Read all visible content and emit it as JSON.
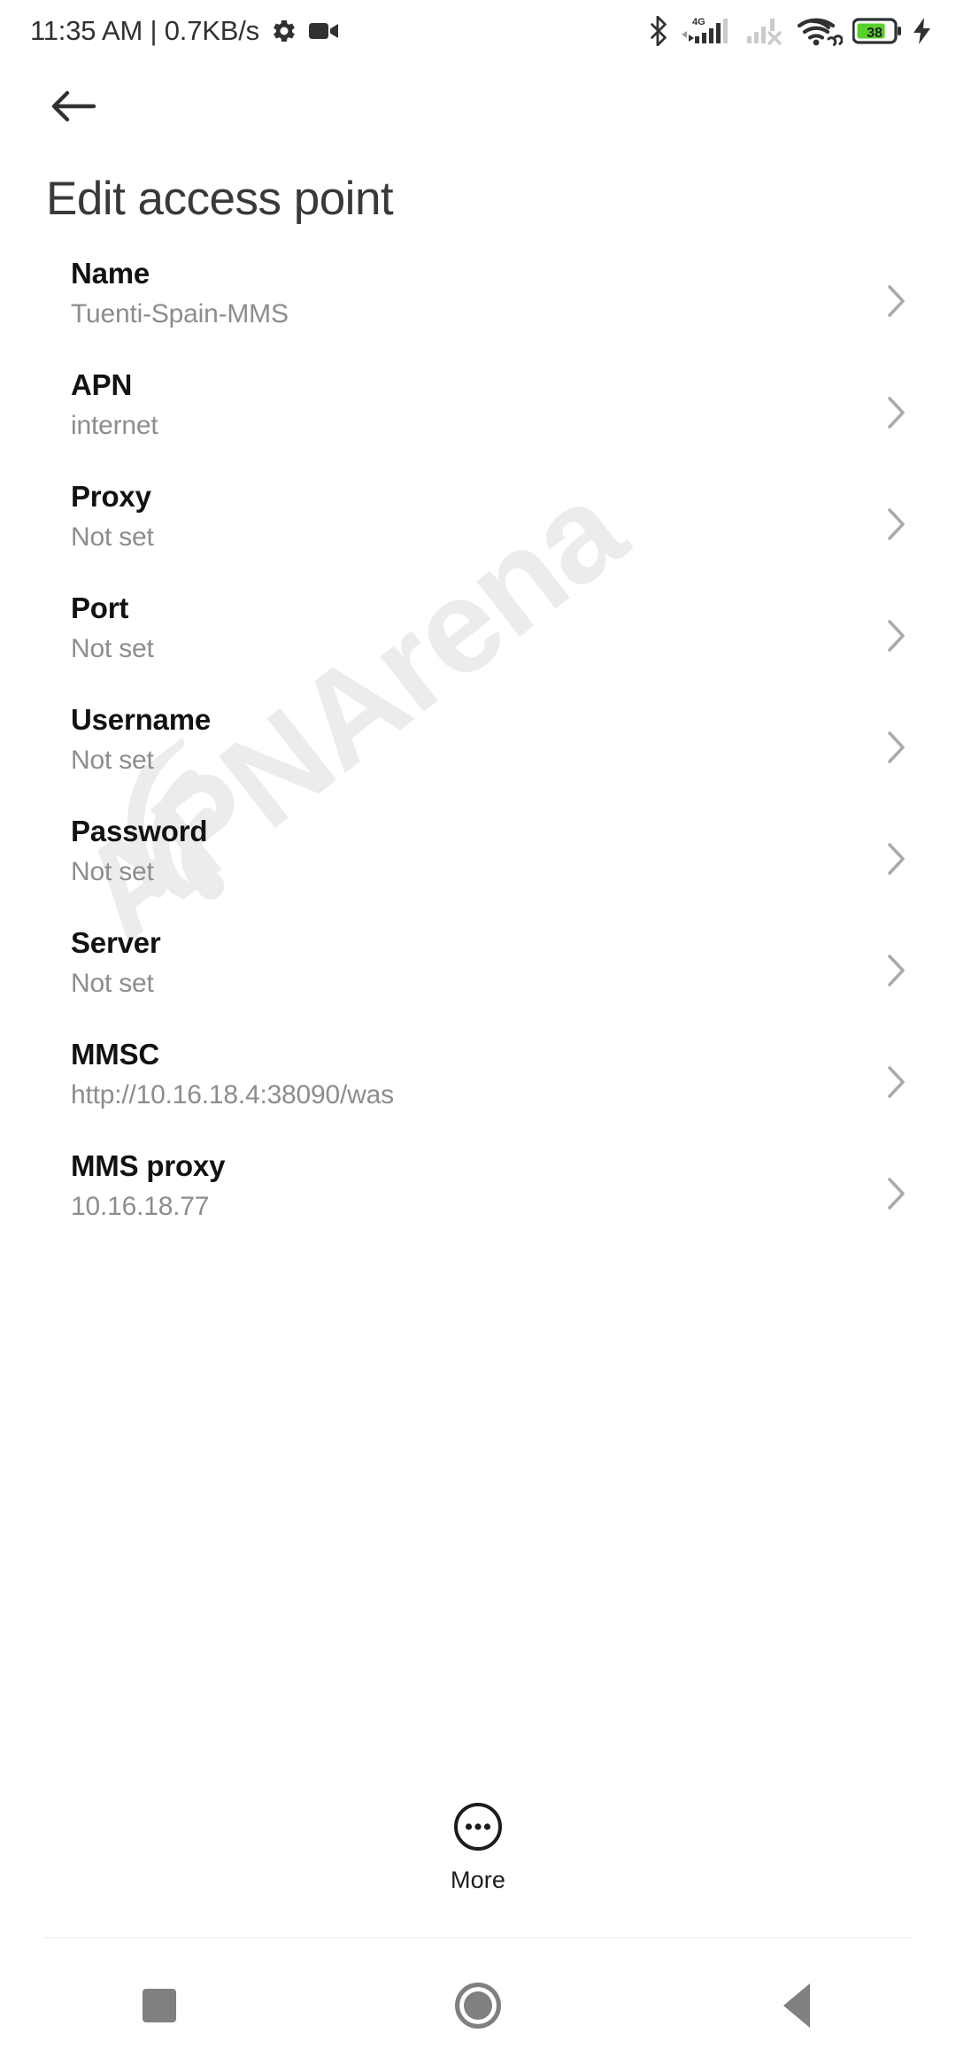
{
  "status_bar": {
    "clock_and_speed": "11:35 AM | 0.7KB/s",
    "left_icons": [
      "gear-icon",
      "video-camera-icon"
    ],
    "right_icons": [
      "bluetooth-icon",
      "signal-4g-icon",
      "sim2-no-service-icon",
      "wifi-link-icon",
      "battery-icon",
      "charging-bolt-icon"
    ],
    "network_type": "4G",
    "battery_percent": "38",
    "battery_color": "#56d12b"
  },
  "app_bar": {
    "back_icon": "arrow-left-icon",
    "title": "Edit access point"
  },
  "watermark": {
    "text": "APNArena"
  },
  "settings": {
    "rows": [
      {
        "title": "Name",
        "value": "Tuenti-Spain-MMS"
      },
      {
        "title": "APN",
        "value": "internet"
      },
      {
        "title": "Proxy",
        "value": "Not set"
      },
      {
        "title": "Port",
        "value": "Not set"
      },
      {
        "title": "Username",
        "value": "Not set"
      },
      {
        "title": "Password",
        "value": "Not set"
      },
      {
        "title": "Server",
        "value": "Not set"
      },
      {
        "title": "MMSC",
        "value": "http://10.16.18.4:38090/was"
      },
      {
        "title": "MMS proxy",
        "value": "10.16.18.77"
      }
    ]
  },
  "more_button": {
    "label": "More",
    "icon": "more-circle-icon"
  },
  "nav_bar": {
    "recents_label": "recents-square-icon",
    "home_label": "home-circle-icon",
    "back_label": "back-triangle-icon"
  }
}
